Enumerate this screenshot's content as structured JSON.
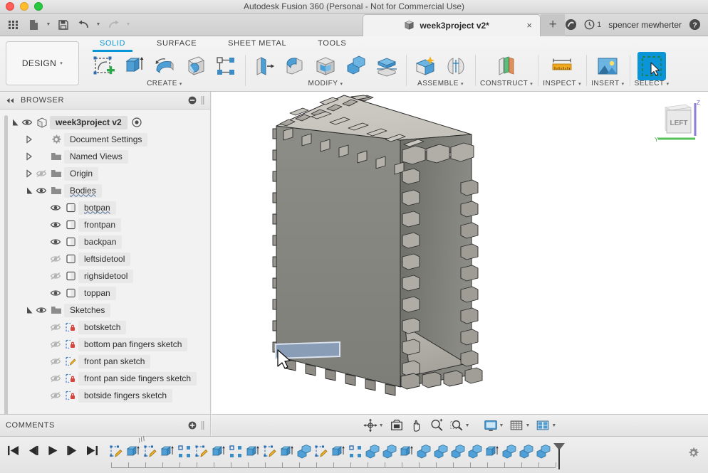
{
  "window": {
    "title": "Autodesk Fusion 360 (Personal - Not for Commercial Use)",
    "traffic_lights": [
      "close",
      "minimize",
      "maximize"
    ]
  },
  "appbar": {
    "quick_access": [
      {
        "name": "apps-grid",
        "icon": "grid-icon"
      },
      {
        "name": "new-file",
        "icon": "file-icon",
        "has_caret": true
      },
      {
        "name": "save",
        "icon": "save-icon"
      },
      {
        "name": "undo",
        "icon": "undo-icon",
        "has_caret": true
      },
      {
        "name": "redo",
        "icon": "redo-icon",
        "has_caret": true
      }
    ],
    "document_tab": {
      "label": "week3project v2*",
      "icon": "cube-icon",
      "close": "×"
    },
    "new_tab_label": "+",
    "data_panel_icon": "fusion-logo-icon",
    "job_status": {
      "icon": "clock-icon",
      "count": "1"
    },
    "user_name": "spencer mewherter",
    "help_icon": "help-icon"
  },
  "ribbon": {
    "design_label": "DESIGN",
    "design_caret": "▾",
    "tabs": [
      {
        "label": "SOLID",
        "active": true
      },
      {
        "label": "SURFACE",
        "active": false
      },
      {
        "label": "SHEET METAL",
        "active": false
      },
      {
        "label": "TOOLS",
        "active": false
      }
    ],
    "groups": [
      {
        "label": "CREATE",
        "caret": "▾",
        "tools": [
          {
            "name": "create-sketch-icon"
          },
          {
            "name": "extrude-icon"
          },
          {
            "name": "revolve-icon"
          },
          {
            "name": "sphere-icon"
          },
          {
            "name": "rectangular-pattern-icon"
          }
        ]
      },
      {
        "label": "MODIFY",
        "caret": "▾",
        "tools": [
          {
            "name": "press-pull-icon"
          },
          {
            "name": "fillet-icon"
          },
          {
            "name": "shell-icon"
          },
          {
            "name": "combine-icon"
          },
          {
            "name": "split-face-icon"
          }
        ]
      },
      {
        "label": "ASSEMBLE",
        "caret": "▾",
        "tools": [
          {
            "name": "new-component-icon"
          },
          {
            "name": "joint-icon"
          }
        ]
      },
      {
        "label": "CONSTRUCT",
        "caret": "▾",
        "tools": [
          {
            "name": "offset-plane-icon"
          }
        ]
      },
      {
        "label": "INSPECT",
        "caret": "▾",
        "tools": [
          {
            "name": "measure-ruler-icon"
          }
        ]
      },
      {
        "label": "INSERT",
        "caret": "▾",
        "tools": [
          {
            "name": "insert-image-icon"
          }
        ]
      },
      {
        "label": "SELECT",
        "caret": "▾",
        "selected": true,
        "tools": [
          {
            "name": "select-cursor-icon"
          }
        ]
      }
    ]
  },
  "browser": {
    "title": "BROWSER",
    "collapse_icon": "collapse-left-icon",
    "minimize_icon": "minus-circle-icon",
    "grip_icon": "grip-icon",
    "tree": [
      {
        "label": "week3project v2",
        "level": 0,
        "arrow": "expanded",
        "eye": "visible",
        "icon": "component-cube-icon",
        "radio": true,
        "root": true
      },
      {
        "label": "Document Settings",
        "level": 1,
        "arrow": "collapsed",
        "eye": "none",
        "icon": "gear-icon"
      },
      {
        "label": "Named Views",
        "level": 1,
        "arrow": "collapsed",
        "eye": "none",
        "icon": "folder-icon"
      },
      {
        "label": "Origin",
        "level": 1,
        "arrow": "collapsed",
        "eye": "hidden",
        "icon": "folder-icon"
      },
      {
        "label": "Bodies",
        "level": 1,
        "arrow": "expanded",
        "eye": "visible",
        "icon": "folder-icon",
        "squiggle": true
      },
      {
        "label": "botpan",
        "level": 2,
        "arrow": "none",
        "eye": "visible",
        "icon": "body-icon",
        "squiggle": true
      },
      {
        "label": "frontpan",
        "level": 2,
        "arrow": "none",
        "eye": "visible",
        "icon": "body-icon"
      },
      {
        "label": "backpan",
        "level": 2,
        "arrow": "none",
        "eye": "visible",
        "icon": "body-icon"
      },
      {
        "label": "leftsidetool",
        "level": 2,
        "arrow": "none",
        "eye": "hidden",
        "icon": "body-icon"
      },
      {
        "label": "righsidetool",
        "level": 2,
        "arrow": "none",
        "eye": "hidden",
        "icon": "body-icon"
      },
      {
        "label": "toppan",
        "level": 2,
        "arrow": "none",
        "eye": "visible",
        "icon": "body-icon"
      },
      {
        "label": "Sketches",
        "level": 1,
        "arrow": "expanded",
        "eye": "visible",
        "icon": "folder-icon"
      },
      {
        "label": "botsketch",
        "level": 2,
        "arrow": "none",
        "eye": "hidden",
        "icon": "sketch-locked-icon"
      },
      {
        "label": "bottom pan fingers sketch",
        "level": 2,
        "arrow": "none",
        "eye": "hidden",
        "icon": "sketch-locked-icon"
      },
      {
        "label": "front pan sketch",
        "level": 2,
        "arrow": "none",
        "eye": "hidden",
        "icon": "sketch-edit-icon"
      },
      {
        "label": "front pan side fingers sketch",
        "level": 2,
        "arrow": "none",
        "eye": "hidden",
        "icon": "sketch-locked-icon"
      },
      {
        "label": "botside fingers sketch",
        "level": 2,
        "arrow": "none",
        "eye": "hidden",
        "icon": "sketch-locked-icon"
      }
    ]
  },
  "comments": {
    "title": "COMMENTS",
    "add_icon": "plus-circle-icon",
    "grip_icon": "grip-icon"
  },
  "viewport": {
    "viewcube_face": "LEFT",
    "axis_labels": {
      "z": "Z",
      "y": "Y"
    },
    "model_description": "finger-jointed box body",
    "selected_face_color": "#7e96b4"
  },
  "navbar": {
    "buttons": [
      {
        "name": "orbit-icon",
        "caret": true
      },
      {
        "name": "look-at-icon",
        "caret": false
      },
      {
        "name": "pan-icon",
        "caret": false
      },
      {
        "name": "zoom-icon",
        "caret": false
      },
      {
        "name": "zoom-window-icon",
        "caret": true
      },
      {
        "name": "display-settings-icon",
        "caret": true
      },
      {
        "name": "grid-snaps-icon",
        "caret": true
      },
      {
        "name": "viewports-icon",
        "caret": true
      }
    ]
  },
  "timeline": {
    "playback": [
      {
        "name": "go-to-beginning-icon"
      },
      {
        "name": "step-back-icon"
      },
      {
        "name": "play-icon"
      },
      {
        "name": "step-forward-icon"
      },
      {
        "name": "go-to-end-icon"
      }
    ],
    "features": [
      "sketch",
      "extrude",
      "sketch",
      "extrude",
      "pattern",
      "sketch",
      "extrude",
      "pattern",
      "extrude",
      "sketch",
      "extrude",
      "combine",
      "sketch",
      "extrude",
      "pattern",
      "combine",
      "combine",
      "extrude",
      "combine",
      "combine",
      "combine",
      "combine",
      "extrude",
      "combine",
      "combine",
      "combine"
    ],
    "marker_position": "end",
    "settings_icon": "gear-icon"
  },
  "colors": {
    "accent_blue": "#0696d7",
    "tool_blue": "#3d90c9",
    "model_gray": "#8a8a84",
    "viewport_bg": "#ffffff"
  }
}
